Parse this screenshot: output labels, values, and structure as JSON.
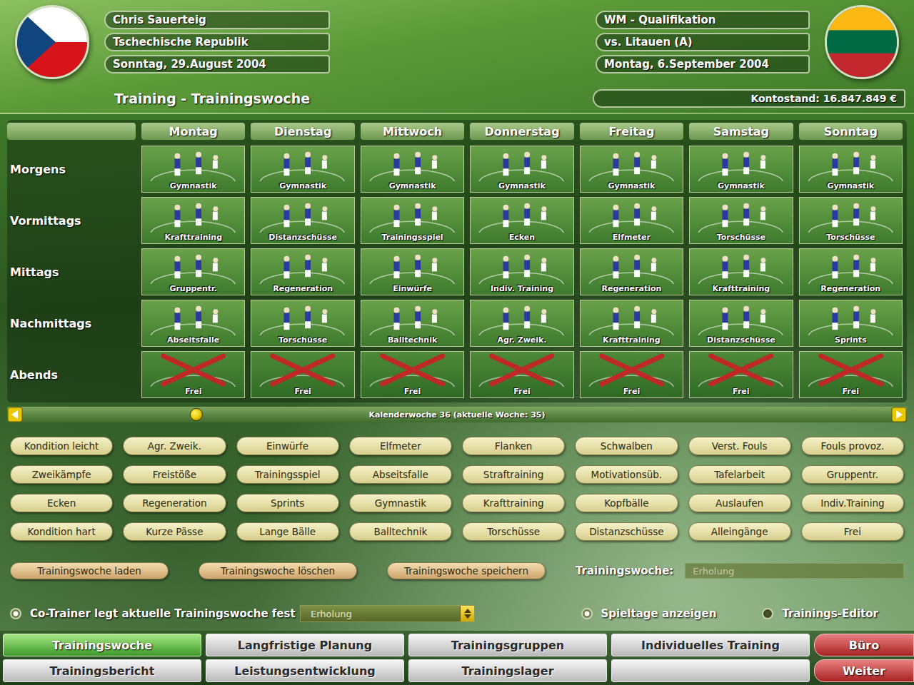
{
  "manager": {
    "name": "Chris Sauerteig",
    "country": "Tschechische Republik",
    "date": "Sonntag, 29.August 2004"
  },
  "next_match": {
    "competition": "WM - Qualifikation",
    "opponent": "vs. Litauen (A)",
    "date": "Montag, 6.September 2004"
  },
  "title": "Training - Trainingswoche",
  "balance": "Kontostand: 16.847.849 €",
  "days": [
    "Montag",
    "Dienstag",
    "Mittwoch",
    "Donnerstag",
    "Freitag",
    "Samstag",
    "Sonntag"
  ],
  "schedule": [
    {
      "slot": "Morgens",
      "cells": [
        {
          "label": "Gymnastik",
          "kind": "training"
        },
        {
          "label": "Gymnastik",
          "kind": "training"
        },
        {
          "label": "Gymnastik",
          "kind": "training"
        },
        {
          "label": "Gymnastik",
          "kind": "training"
        },
        {
          "label": "Gymnastik",
          "kind": "training"
        },
        {
          "label": "Gymnastik",
          "kind": "training"
        },
        {
          "label": "Gymnastik",
          "kind": "training"
        }
      ]
    },
    {
      "slot": "Vormittags",
      "cells": [
        {
          "label": "Krafttraining",
          "kind": "training"
        },
        {
          "label": "Distanzschüsse",
          "kind": "training"
        },
        {
          "label": "Trainingsspiel",
          "kind": "training"
        },
        {
          "label": "Ecken",
          "kind": "training"
        },
        {
          "label": "Elfmeter",
          "kind": "training"
        },
        {
          "label": "Torschüsse",
          "kind": "training"
        },
        {
          "label": "Torschüsse",
          "kind": "training"
        }
      ]
    },
    {
      "slot": "Mittags",
      "cells": [
        {
          "label": "Gruppentr.",
          "kind": "training"
        },
        {
          "label": "Regeneration",
          "kind": "training"
        },
        {
          "label": "Einwürfe",
          "kind": "training"
        },
        {
          "label": "Indiv. Training",
          "kind": "training"
        },
        {
          "label": "Regeneration",
          "kind": "training"
        },
        {
          "label": "Krafttraining",
          "kind": "training"
        },
        {
          "label": "Regeneration",
          "kind": "training"
        }
      ]
    },
    {
      "slot": "Nachmittags",
      "cells": [
        {
          "label": "Abseitsfalle",
          "kind": "training"
        },
        {
          "label": "Torschüsse",
          "kind": "training"
        },
        {
          "label": "Balltechnik",
          "kind": "training"
        },
        {
          "label": "Agr. Zweik.",
          "kind": "training"
        },
        {
          "label": "Krafttraining",
          "kind": "training"
        },
        {
          "label": "Distanzschüsse",
          "kind": "training"
        },
        {
          "label": "Sprints",
          "kind": "training"
        }
      ]
    },
    {
      "slot": "Abends",
      "cells": [
        {
          "label": "Frei",
          "kind": "frei"
        },
        {
          "label": "Frei",
          "kind": "frei"
        },
        {
          "label": "Frei",
          "kind": "frei"
        },
        {
          "label": "Frei",
          "kind": "frei"
        },
        {
          "label": "Frei",
          "kind": "frei"
        },
        {
          "label": "Frei",
          "kind": "frei"
        },
        {
          "label": "Frei",
          "kind": "frei"
        }
      ]
    }
  ],
  "calendar": {
    "label": "Kalenderwoche 36 (aktuelle Woche: 35)",
    "level": 0.2
  },
  "drills": [
    "Kondition leicht",
    "Agr. Zweik.",
    "Einwürfe",
    "Elfmeter",
    "Flanken",
    "Schwalben",
    "Verst. Fouls",
    "Fouls provoz.",
    "Zweikämpfe",
    "Freistöße",
    "Trainingsspiel",
    "Abseitsfalle",
    "Straftraining",
    "Motivationsüb.",
    "Tafelarbeit",
    "Gruppentr.",
    "Ecken",
    "Regeneration",
    "Sprints",
    "Gymnastik",
    "Krafttraining",
    "Kopfbälle",
    "Auslaufen",
    "Indiv.Training",
    "Kondition hart",
    "Kurze Pässe",
    "Lange Bälle",
    "Balltechnik",
    "Torschüsse",
    "Distanzschüsse",
    "Alleingänge",
    "Frei"
  ],
  "week_actions": [
    "Trainingswoche laden",
    "Trainingswoche löschen",
    "Trainingswoche speichern"
  ],
  "week_field": {
    "label": "Trainingswoche:",
    "value": "Erholung",
    "disabled": true
  },
  "co_trainer": {
    "label": "Co-Trainer legt aktuelle Trainingswoche fest",
    "checked": true,
    "preset": "Erholung"
  },
  "toggles": [
    {
      "label": "Spieltage anzeigen",
      "checked": true
    },
    {
      "label": "Trainings-Editor",
      "checked": false
    }
  ],
  "nav": [
    [
      {
        "label": "Trainingswoche",
        "selected": true,
        "kind": "tab"
      },
      {
        "label": "Langfristige Planung",
        "selected": false,
        "kind": "tab"
      },
      {
        "label": "Trainingsgruppen",
        "selected": false,
        "kind": "tab"
      },
      {
        "label": "Individuelles Training",
        "selected": false,
        "kind": "tab"
      },
      {
        "label": "Büro",
        "selected": false,
        "kind": "exit"
      }
    ],
    [
      {
        "label": "Trainingsbericht",
        "selected": false,
        "kind": "tab"
      },
      {
        "label": "Leistungsentwicklung",
        "selected": false,
        "kind": "tab"
      },
      {
        "label": "Trainingslager",
        "selected": false,
        "kind": "tab"
      },
      {
        "label": "",
        "selected": false,
        "kind": "blank"
      },
      {
        "label": "Weiter",
        "selected": false,
        "kind": "exit"
      }
    ]
  ]
}
